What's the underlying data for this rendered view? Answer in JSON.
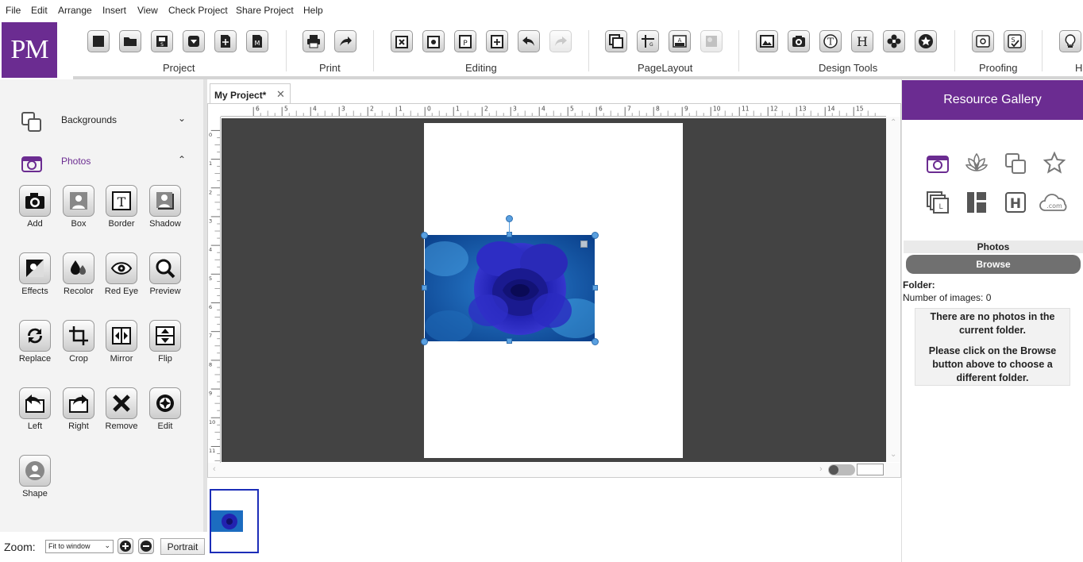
{
  "menu": [
    "File",
    "Edit",
    "Arrange",
    "Insert",
    "View",
    "Check Project",
    "Share Project",
    "Help"
  ],
  "logo": "PM",
  "ribbon": {
    "groups": [
      {
        "label": "Project",
        "buttons": [
          "window-icon",
          "folder-icon",
          "save-icon",
          "save-as-icon",
          "new-file-icon",
          "page-icon"
        ]
      },
      {
        "label": "Print",
        "buttons": [
          "printer-icon",
          "send-icon"
        ]
      },
      {
        "label": "Editing",
        "buttons": [
          "cut-icon",
          "copy-icon",
          "paste-icon",
          "add-icon",
          "undo-icon",
          "redo-icon"
        ]
      },
      {
        "label": "PageLayout",
        "buttons": [
          "layout-icon",
          "grid-icon",
          "text-layout-icon",
          "background-icon"
        ]
      },
      {
        "label": "Design Tools",
        "buttons": [
          "image-icon",
          "camera-icon",
          "textbox-icon",
          "heading-icon",
          "flower-icon",
          "star-icon"
        ]
      },
      {
        "label": "Proofing",
        "buttons": [
          "view-icon",
          "spellcheck-icon"
        ]
      },
      {
        "label": "H",
        "buttons": [
          "help-bulb-icon"
        ]
      }
    ]
  },
  "left_panel": {
    "sections": [
      {
        "label": "Backgrounds",
        "expanded": false
      },
      {
        "label": "Photos",
        "expanded": true
      }
    ],
    "tools": [
      {
        "label": "Add",
        "icon": "camera-icon"
      },
      {
        "label": "Box",
        "icon": "box-person-icon"
      },
      {
        "label": "Border",
        "icon": "border-t-icon"
      },
      {
        "label": "Shadow",
        "icon": "shadow-person-icon"
      },
      {
        "label": "Effects",
        "icon": "effects-icon"
      },
      {
        "label": "Recolor",
        "icon": "recolor-drops-icon"
      },
      {
        "label": "Red Eye",
        "icon": "eye-icon"
      },
      {
        "label": "Preview",
        "icon": "magnifier-icon"
      },
      {
        "label": "Replace",
        "icon": "replace-arrows-icon"
      },
      {
        "label": "Crop",
        "icon": "crop-icon"
      },
      {
        "label": "Mirror",
        "icon": "mirror-icon"
      },
      {
        "label": "Flip",
        "icon": "flip-icon"
      },
      {
        "label": "Left",
        "icon": "rotate-left-icon"
      },
      {
        "label": "Right",
        "icon": "rotate-right-icon"
      },
      {
        "label": "Remove",
        "icon": "remove-x-icon"
      },
      {
        "label": "Edit",
        "icon": "edit-aperture-icon"
      },
      {
        "label": "Shape",
        "icon": "shape-person-icon"
      }
    ]
  },
  "zoom": {
    "label": "Zoom:",
    "value": "Fit to window",
    "orientation": "Portrait"
  },
  "document": {
    "tab_title": "My Project*",
    "close": "✕",
    "hruler_labels": [
      "6",
      "5",
      "4",
      "3",
      "2",
      "1",
      "0",
      "1",
      "2",
      "3",
      "4",
      "5",
      "6",
      "7",
      "8",
      "9",
      "10",
      "11",
      "12",
      "13",
      "14",
      "15"
    ],
    "vruler_labels": [
      "0",
      "1",
      "2",
      "3",
      "4",
      "5",
      "6",
      "7",
      "8",
      "9",
      "10",
      "11"
    ]
  },
  "right_panel": {
    "header": "Resource Gallery",
    "icons": [
      "photo-camera-icon",
      "lotus-icon",
      "layers-icon",
      "star-outline-icon",
      "layout-stack-icon",
      "columns-layout-icon",
      "heading-h-icon",
      "cloud-com-icon"
    ],
    "cloud_text": ".com",
    "section_title": "Photos",
    "browse": "Browse",
    "folder_label": "Folder:",
    "num_images": "Number of images: 0",
    "message1": "There are no photos in the current folder.",
    "message2": "Please click on the Browse button above to choose a different folder."
  },
  "colors": {
    "brand": "#6b2c91",
    "workarea": "#434343",
    "selection": "#5aa0e0"
  }
}
